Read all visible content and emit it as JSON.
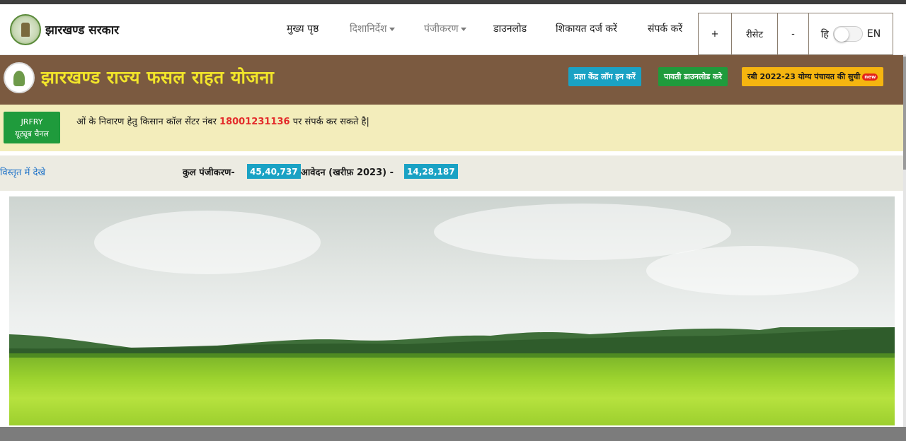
{
  "header": {
    "gov_name": "झारखण्ड सरकार",
    "nav": [
      {
        "label": "मुख्य पृष्ठ",
        "dropdown": false
      },
      {
        "label": "दिशानिर्देश",
        "dropdown": true
      },
      {
        "label": "पंजीकरण",
        "dropdown": true
      },
      {
        "label": "डाउनलोड",
        "dropdown": false
      },
      {
        "label": "शिकायत दर्ज करें",
        "dropdown": false
      },
      {
        "label": "संपर्क करें",
        "dropdown": false
      }
    ],
    "font_controls": {
      "increase": "+",
      "reset": "रीसेट",
      "decrease": "-"
    },
    "lang": {
      "hindi": "हि",
      "english": "EN"
    }
  },
  "banner": {
    "title": "झारखण्ड राज्य फसल राहत योजना",
    "buttons": [
      {
        "label": "प्रज्ञा केंद्र लॉग इन करें",
        "color": "#1aa2c4"
      },
      {
        "label": "पावती डाउनलोड करे",
        "color": "#1f9b3c"
      },
      {
        "label": "रबी 2022-23 योग्य पंचायत की सुची",
        "color": "#f5b510",
        "badge": "new"
      }
    ]
  },
  "notice": {
    "youtube_line1": "JRFRY",
    "youtube_line2": "यूट्यूब चैनल",
    "text_before": "ओं के निवारण हेतु किसान कॉल सेंटर नंबर",
    "helpline": "18001231136",
    "text_after": "पर संपर्क कर सकते है|"
  },
  "stats": {
    "details_link": "विस्तृत में देखे",
    "total_label": "कुल पंजीकरण-",
    "total_value": "45,40,737",
    "applications_label": "आवेदन (खरीफ़ 2023) -",
    "applications_value": "14,28,187"
  },
  "colors": {
    "banner_bg": "#7b5a40",
    "title_yellow": "#f2e52a",
    "notice_bg": "#f3edbb",
    "stat_badge": "#1aa2c4",
    "helpline_red": "#e32b2b"
  }
}
